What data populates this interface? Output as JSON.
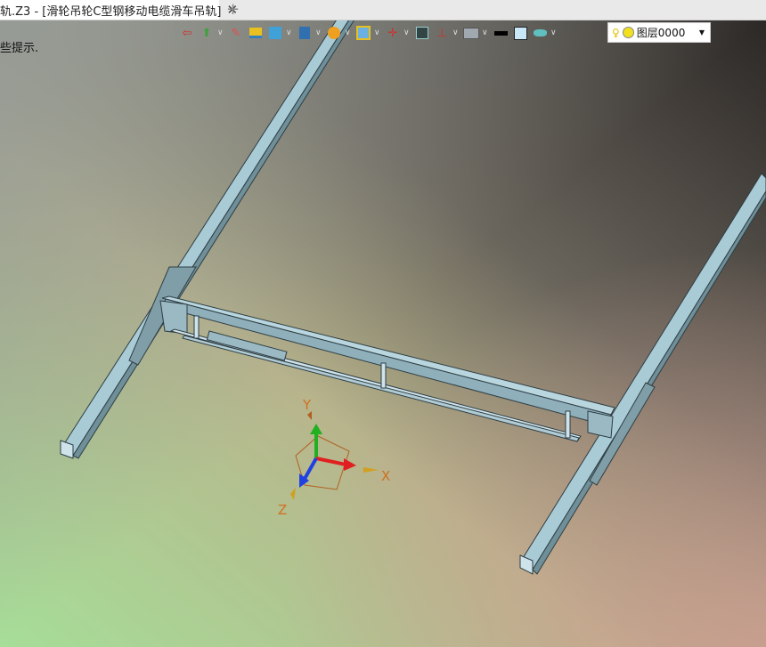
{
  "tab": {
    "title": "轨.Z3 - [滑轮吊轮C型钢移动电缆滑车吊轨]",
    "close": "✕",
    "new_tab": "+"
  },
  "hint": "些提示.",
  "toolbar": {
    "icons": [
      "exit-sketch-icon",
      "cursor-pick-icon",
      "paint-icon",
      "face-icon",
      "solid-box-icon",
      "display-icon",
      "render-sphere-icon",
      "zoom-view-icon",
      "origin-icon",
      "camera-icon",
      "section-icon",
      "monitor-icon",
      "line-color-icon",
      "fill-color-icon",
      "material-icon"
    ]
  },
  "layer": {
    "name": "图层0000",
    "bulb": "💡"
  },
  "triad": {
    "x": "X",
    "y": "Y",
    "z": "Z"
  },
  "colors": {
    "model": "#a9cbd6",
    "edge": "#2e3d44",
    "x_axis": "#e02020",
    "y_axis": "#20b020",
    "z_axis": "#2040e0",
    "label": "#d07020"
  }
}
